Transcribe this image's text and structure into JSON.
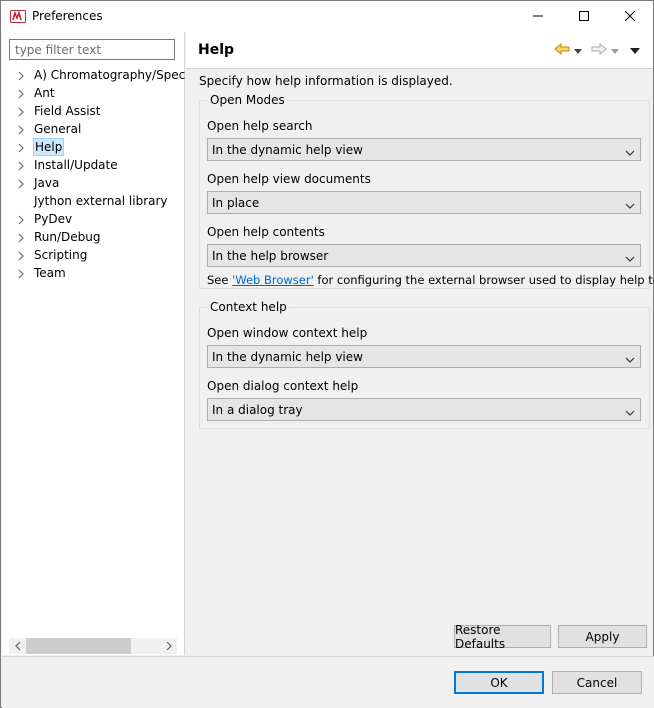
{
  "window": {
    "title": "Preferences"
  },
  "filter": {
    "placeholder": "type filter text"
  },
  "tree": {
    "items": [
      {
        "label": "A) Chromatography/Spectr",
        "expandable": true
      },
      {
        "label": "Ant",
        "expandable": true
      },
      {
        "label": "Field Assist",
        "expandable": true
      },
      {
        "label": "General",
        "expandable": true
      },
      {
        "label": "Help",
        "expandable": true,
        "selected": true
      },
      {
        "label": "Install/Update",
        "expandable": true
      },
      {
        "label": "Java",
        "expandable": true
      },
      {
        "label": "Jython external library",
        "expandable": false
      },
      {
        "label": "PyDev",
        "expandable": true
      },
      {
        "label": "Run/Debug",
        "expandable": true
      },
      {
        "label": "Scripting",
        "expandable": true
      },
      {
        "label": "Team",
        "expandable": true
      }
    ]
  },
  "page": {
    "title": "Help",
    "description": "Specify how help information is displayed.",
    "open_modes": {
      "legend": "Open Modes",
      "search_label": "Open help search",
      "search_value": "In the dynamic help view",
      "documents_label": "Open help view documents",
      "documents_value": "In place",
      "contents_label": "Open help contents",
      "contents_value": "In the help browser",
      "see_prefix": "See ",
      "see_link": "'Web Browser'",
      "see_suffix": " for configuring the external browser used to display help topics."
    },
    "context_help": {
      "legend": "Context help",
      "window_label": "Open window context help",
      "window_value": "In the dynamic help view",
      "dialog_label": "Open dialog context help",
      "dialog_value": "In a dialog tray"
    },
    "restore_defaults": "Restore Defaults",
    "apply": "Apply"
  },
  "dialog": {
    "ok": "OK",
    "cancel": "Cancel"
  },
  "colors": {
    "accent": "#0078d7",
    "selection": "#cce8ff",
    "link": "#0066cc",
    "back_arrow": "#e8a200"
  }
}
